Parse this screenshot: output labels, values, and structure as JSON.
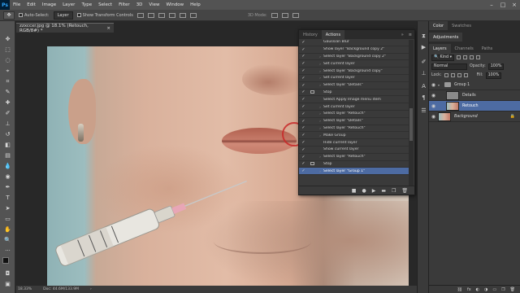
{
  "menu": {
    "logo": "Ps",
    "items": [
      "File",
      "Edit",
      "Image",
      "Layer",
      "Type",
      "Select",
      "Filter",
      "3D",
      "View",
      "Window",
      "Help"
    ],
    "window_controls": [
      "–",
      "□",
      "×"
    ]
  },
  "options": {
    "auto_select_label": "Auto-Select:",
    "auto_select_value": "Layer",
    "transform_label": "Show Transform Controls",
    "mode3d_label": "3D Mode:"
  },
  "document": {
    "tab_title": "zzxccxr.jpg @ 18.1% (Retouch, RGB/8#) *",
    "close_glyph": "×"
  },
  "actions_panel": {
    "tabs": [
      "History",
      "Actions"
    ],
    "active_tab": "Actions",
    "collapse_glyph": "»",
    "menu_glyph": "≡",
    "rows": [
      {
        "label": "Gaussian Blur",
        "checked": true,
        "dialog": false,
        "expandable": false
      },
      {
        "label": "Show layer \"Background copy 2\"",
        "checked": true,
        "dialog": false,
        "expandable": false
      },
      {
        "label": "Select layer \"Background copy 2\"",
        "checked": true,
        "dialog": false,
        "expandable": true
      },
      {
        "label": "Set current layer",
        "checked": true,
        "dialog": false,
        "expandable": true
      },
      {
        "label": "Select layer \"Background copy\"",
        "checked": true,
        "dialog": false,
        "expandable": true
      },
      {
        "label": "Set current layer",
        "checked": true,
        "dialog": false,
        "expandable": true
      },
      {
        "label": "Select layer \"Details\"",
        "checked": true,
        "dialog": false,
        "expandable": true
      },
      {
        "label": "Stop",
        "checked": true,
        "dialog": true,
        "expandable": false
      },
      {
        "label": "Select Apply Image menu item",
        "checked": true,
        "dialog": false,
        "expandable": false
      },
      {
        "label": "Set current layer",
        "checked": true,
        "dialog": false,
        "expandable": true
      },
      {
        "label": "Select layer \"Retouch\"",
        "checked": true,
        "dialog": false,
        "expandable": true
      },
      {
        "label": "Select layer \"Details\"",
        "checked": true,
        "dialog": false,
        "expandable": true
      },
      {
        "label": "Select layer \"Retouch\"",
        "checked": true,
        "dialog": false,
        "expandable": true
      },
      {
        "label": "Make Group",
        "checked": true,
        "dialog": false,
        "expandable": true
      },
      {
        "label": "Hide current layer",
        "checked": true,
        "dialog": false,
        "expandable": false
      },
      {
        "label": "Show current layer",
        "checked": true,
        "dialog": false,
        "expandable": false
      },
      {
        "label": "Select layer \"Retouch\"",
        "checked": true,
        "dialog": false,
        "expandable": true
      },
      {
        "label": "Stop",
        "checked": true,
        "dialog": true,
        "expandable": false
      },
      {
        "label": "Select layer \"Group 1\"",
        "checked": true,
        "dialog": false,
        "expandable": true,
        "selected": true
      }
    ],
    "footer_glyphs": [
      "■",
      "●",
      "▶",
      "▬",
      "❐",
      "🗑"
    ]
  },
  "status": {
    "zoom": "18.33%",
    "doc": "Doc: 44.6M/133.9M",
    "arrow": "›"
  },
  "right_panel": {
    "top_tabs": [
      "Color",
      "Swatches"
    ],
    "adjustments_tab": "Adjustments",
    "layer_tabs": [
      "Layers",
      "Channels",
      "Paths"
    ],
    "kind_label": "Kind",
    "blend_mode": "Normal",
    "opacity_label": "Opacity:",
    "opacity_value": "100%",
    "lock_label": "Lock:",
    "fill_label": "Fill:",
    "fill_value": "100%",
    "layers": [
      {
        "name": "Group 1",
        "type": "group"
      },
      {
        "name": "Details",
        "type": "layer",
        "indent": true
      },
      {
        "name": "Retouch",
        "type": "layer",
        "indent": true,
        "selected": true
      },
      {
        "name": "Background",
        "type": "background",
        "italic": true
      }
    ],
    "footer_glyphs": [
      "⛓",
      "fx",
      "◐",
      "◑",
      "▭",
      "❐",
      "🗑"
    ]
  },
  "colors": {
    "selection": "#4d6ba2",
    "ui_dark": "#282828",
    "panel": "#3a3a3a",
    "annotation_circle": "#c82828"
  }
}
